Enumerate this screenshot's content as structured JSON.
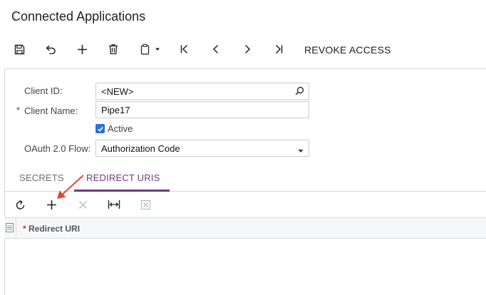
{
  "page": {
    "title": "Connected Applications"
  },
  "toolbar": {
    "save_icon": "save-icon",
    "undo_icon": "undo-icon",
    "add_icon": "plus-icon",
    "delete_icon": "trash-icon",
    "copy_icon": "clipboard-icon",
    "first_icon": "first-record-icon",
    "prev_icon": "chevron-left-icon",
    "next_icon": "chevron-right-icon",
    "last_icon": "last-record-icon",
    "revoke_label": "REVOKE ACCESS"
  },
  "form": {
    "client_id_label": "Client ID:",
    "client_id_value": "<NEW>",
    "client_name_label": "Client Name:",
    "client_name_required": "*",
    "client_name_value": "Pipe17",
    "active_label": "Active",
    "active_checked": true,
    "oauth_label": "OAuth 2.0 Flow:",
    "oauth_value": "Authorization Code"
  },
  "tabs": [
    {
      "label": "SECRETS",
      "active": false
    },
    {
      "label": "REDIRECT URIS",
      "active": true
    }
  ],
  "grid": {
    "columns": [
      {
        "label": "Redirect URI",
        "required": "*"
      }
    ],
    "rows": []
  },
  "colors": {
    "accent_tab": "#6a3d7c",
    "checkbox": "#2f6fd0",
    "annotation_arrow": "#e8432c"
  }
}
